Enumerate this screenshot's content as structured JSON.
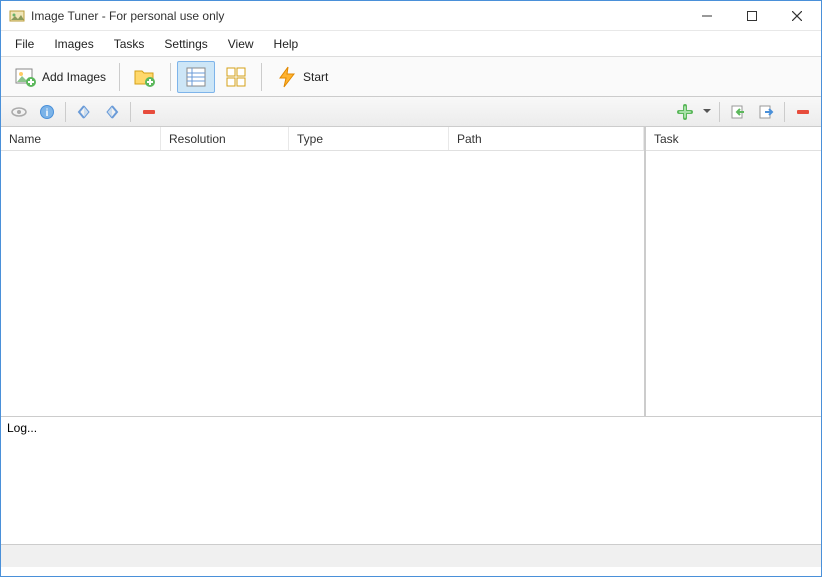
{
  "window": {
    "title": "Image Tuner - For personal use only"
  },
  "menu": {
    "file": "File",
    "images": "Images",
    "tasks": "Tasks",
    "settings": "Settings",
    "view": "View",
    "help": "Help"
  },
  "toolbar": {
    "add_images": "Add Images",
    "start": "Start"
  },
  "columns": {
    "name": "Name",
    "resolution": "Resolution",
    "type": "Type",
    "path": "Path",
    "task": "Task"
  },
  "log": {
    "label": "Log..."
  }
}
